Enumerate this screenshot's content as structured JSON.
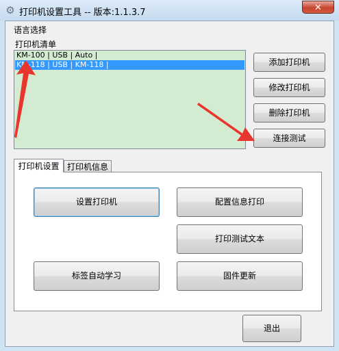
{
  "window": {
    "title": "打印机设置工具 -- 版本:1.1.3.7",
    "close_label": "✕"
  },
  "menu": {
    "language_label": "语言选择"
  },
  "printers": {
    "list_label": "打印机清单",
    "items": [
      "KM-100 | USB | Auto |",
      "KM-118 | USB | KM-118 |"
    ],
    "selected_index": 1
  },
  "side_buttons": {
    "add": "添加打印机",
    "modify": "修改打印机",
    "delete": "删除打印机",
    "connect": "连接测试"
  },
  "tabs": [
    {
      "label": "打印机设置"
    },
    {
      "label": "打印机信息"
    }
  ],
  "panel_buttons": {
    "set_printer": "设置打印机",
    "config_print": "配置信息打印",
    "print_test": "打印测试文本",
    "label_learn": "标签自动学习",
    "firmware": "固件更新"
  },
  "exit_label": "退出",
  "colors": {
    "arrow": "#e8352d",
    "selection": "#3399ff",
    "list_bg": "#d3ebd1"
  }
}
